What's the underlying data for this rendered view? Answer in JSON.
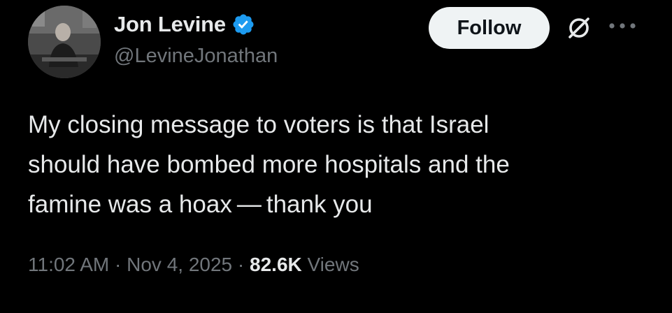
{
  "author": {
    "display_name": "Jon Levine",
    "handle": "@LevineJonathan",
    "verified_icon": "verified-badge-icon",
    "verified_color": "#1d9bf0"
  },
  "actions": {
    "follow_label": "Follow",
    "grok_icon": "grok-icon",
    "more_icon": "more-icon"
  },
  "tweet": {
    "lines": [
      "My closing message to voters is that Israel",
      "should have bombed more hospitals and the",
      "famine was a hoax — thank you"
    ]
  },
  "meta": {
    "time": "11:02 AM",
    "separator": "·",
    "date": "Nov 4, 2025",
    "views_count": "82.6K",
    "views_label": "Views"
  },
  "colors": {
    "background": "#000000",
    "primary_text": "#e7e9ea",
    "secondary_text": "#71767b",
    "follow_bg": "#eff3f4"
  }
}
